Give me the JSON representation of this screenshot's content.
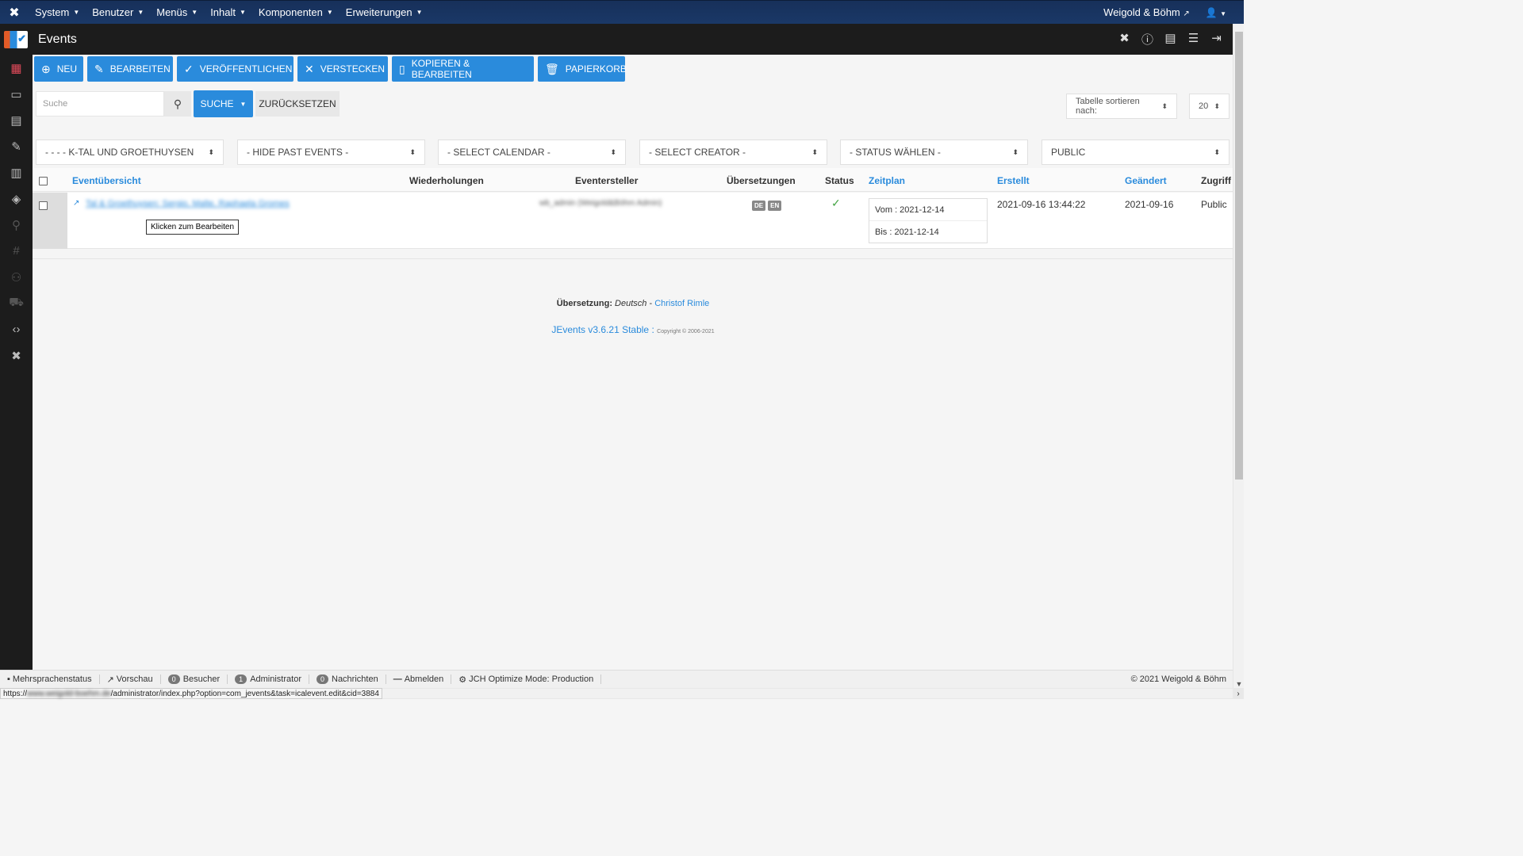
{
  "topnav": {
    "menus": [
      {
        "label": "System"
      },
      {
        "label": "Benutzer"
      },
      {
        "label": "Menüs"
      },
      {
        "label": "Inhalt"
      },
      {
        "label": "Komponenten"
      },
      {
        "label": "Erweiterungen"
      }
    ],
    "site_name": "Weigold & Böhm",
    "site_icon": "external-link-icon",
    "user_icon": "user-icon"
  },
  "header": {
    "title": "Events",
    "tools": [
      "joomla-icon",
      "help-icon",
      "document-icon",
      "options-icon",
      "logout-icon"
    ]
  },
  "sidebar": {
    "items": [
      "calendar-icon",
      "layers-icon",
      "calendar-week-icon",
      "edit-icon",
      "document-icon",
      "paint-bucket-icon",
      "location-icon",
      "hash-icon",
      "user-icon",
      "cart-icon",
      "code-icon",
      "joomla-icon"
    ]
  },
  "toolbar": {
    "new": "NEU",
    "edit": "BEARBEITEN",
    "publish": "VERÖFFENTLICHEN",
    "hide": "VERSTECKEN",
    "copy_edit": "KOPIEREN & BEARBEITEN",
    "trash": "PAPIERKORB"
  },
  "search": {
    "placeholder": "Suche",
    "search_label": "SUCHE",
    "reset_label": "ZURÜCKSETZEN",
    "sort_label": "Tabelle sortieren nach:",
    "limit": "20"
  },
  "filters": {
    "category": "- - - - K-TAL UND GROETHUYSEN",
    "past_events": "- HIDE PAST EVENTS -",
    "calendar": "- SELECT CALENDAR -",
    "creator": "- SELECT CREATOR -",
    "status": "- STATUS WÄHLEN -",
    "access": "PUBLIC"
  },
  "table": {
    "headers": {
      "overview": "Eventübersicht",
      "repeats": "Wiederholungen",
      "creator": "Eventersteller",
      "translations": "Übersetzungen",
      "status": "Status",
      "schedule": "Zeitplan",
      "created": "Erstellt",
      "modified": "Geändert",
      "access": "Zugriff"
    },
    "rows": [
      {
        "title": "Tal & Groethuysen: Sergio, Malte, Raphaela Gromes",
        "tooltip": "Klicken zum Bearbeiten",
        "creator": "wb_admin (Weigold&Böhm Admin)",
        "languages": [
          "DE",
          "EN"
        ],
        "status": "✓",
        "from": "Vom : 2021-12-14",
        "to": "Bis : 2021-12-14",
        "created": "2021-09-16 13:44:22",
        "modified": "2021-09-16",
        "access": "Public"
      }
    ]
  },
  "credits": {
    "translation_label": "Übersetzung:",
    "language": "Deutsch",
    "dash": "-",
    "translator": "Christof Rimle",
    "product": "JEvents v3.6.21 Stable",
    "colon": ":",
    "copyright": "Copyright © 2006-2021"
  },
  "statusbar": {
    "multilang": "Mehrsprachenstatus",
    "preview": "Vorschau",
    "visitors_count": "0",
    "visitors": "Besucher",
    "admins_count": "1",
    "admins": "Administrator",
    "messages_count": "0",
    "messages": "Nachrichten",
    "logout": "Abmelden",
    "jch": "JCH Optimize Mode: Production",
    "copyright": "© 2021 Weigold & Böhm"
  },
  "url": {
    "prefix": "https://",
    "host": "www.weigold-boehm.de",
    "path": "/administrator/index.php?option=com_jevents&task=icalevent.edit&cid=3884"
  },
  "colors": {
    "accent": "#2a8bdc",
    "topnav": "#1a3867",
    "dark": "#1c1c1c",
    "active_sidebar": "#e04a5a",
    "success": "#46a546"
  }
}
